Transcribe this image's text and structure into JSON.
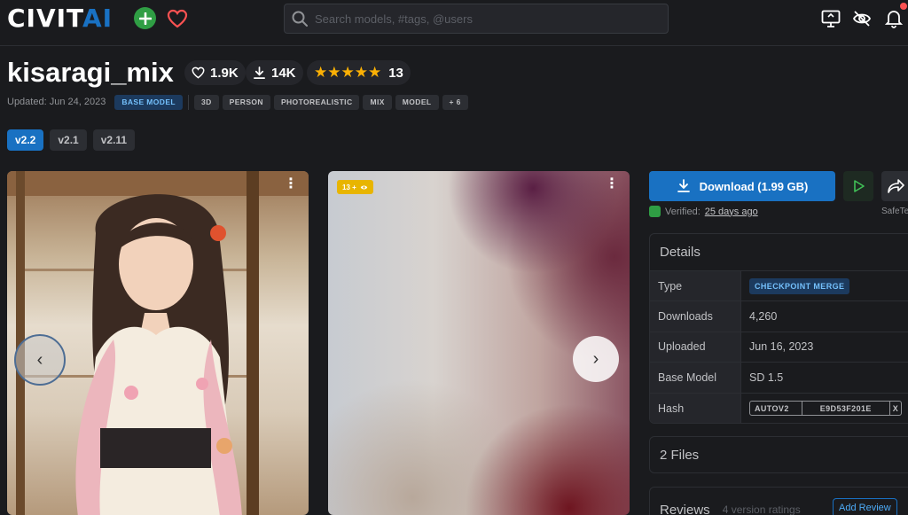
{
  "header": {
    "logo_civit": "CIVIT",
    "logo_ai": "AI",
    "search_placeholder": "Search models, #tags, @users"
  },
  "model": {
    "title": "kisaragi_mix",
    "likes": "1.9K",
    "downloads": "14K",
    "stars": "★★★★★",
    "rating_count": "13",
    "updated": "Updated: Jun 24, 2023",
    "base_tag": "BASE MODEL",
    "tags": [
      "3D",
      "PERSON",
      "PHOTOREALISTIC",
      "MIX",
      "MODEL",
      "+ 6"
    ],
    "versions": [
      "v2.2",
      "v2.1",
      "v2.11"
    ]
  },
  "gallery": {
    "nsfw_badge": "13 +",
    "kebab": "⋮",
    "prev": "‹",
    "next": "›"
  },
  "actions": {
    "download_label": "Download (1.99 GB)",
    "verified_prefix": "Verified:",
    "verified_when": "25 days ago",
    "safe_label": "SafeTensor"
  },
  "details": {
    "heading": "Details",
    "rows": [
      {
        "label": "Type",
        "value": "CHECKPOINT MERGE"
      },
      {
        "label": "Downloads",
        "value": "4,260"
      },
      {
        "label": "Uploaded",
        "value": "Jun 16, 2023"
      },
      {
        "label": "Base Model",
        "value": "SD 1.5"
      },
      {
        "label": "Hash",
        "algo": "AUTOV2",
        "value": "E9D53F201E",
        "extra": "X"
      }
    ]
  },
  "files": {
    "label": "2 Files"
  },
  "reviews": {
    "label": "Reviews",
    "count": "4 version ratings",
    "add": "Add Review"
  },
  "colors": {
    "accent": "#1971c2",
    "star": "#fab005",
    "add": "#2f9e44",
    "heart": "#fa5252",
    "bg": "#1a1b1e"
  }
}
